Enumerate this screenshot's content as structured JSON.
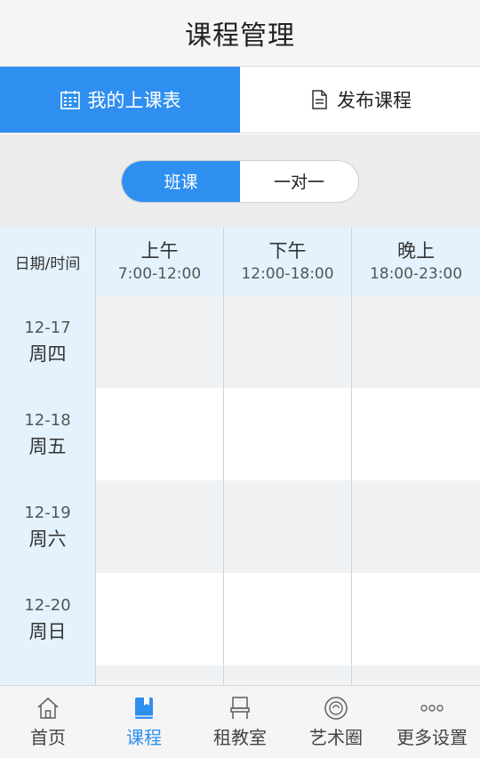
{
  "header": {
    "title": "课程管理"
  },
  "top_tabs": [
    {
      "label": "我的上课表",
      "icon": "calendar-icon",
      "active": true
    },
    {
      "label": "发布课程",
      "icon": "document-icon",
      "active": false
    }
  ],
  "segment": [
    {
      "label": "班课",
      "active": true
    },
    {
      "label": "一对一",
      "active": false
    }
  ],
  "schedule": {
    "corner_label": "日期/时间",
    "periods": [
      {
        "name": "上午",
        "time": "7:00-12:00"
      },
      {
        "name": "下午",
        "time": "12:00-18:00"
      },
      {
        "name": "晚上",
        "time": "18:00-23:00"
      }
    ],
    "rows": [
      {
        "date": "12-17",
        "weekday": "周四"
      },
      {
        "date": "12-18",
        "weekday": "周五"
      },
      {
        "date": "12-19",
        "weekday": "周六"
      },
      {
        "date": "12-20",
        "weekday": "周日"
      }
    ]
  },
  "bottom_nav": [
    {
      "label": "首页",
      "icon": "home-icon",
      "active": false
    },
    {
      "label": "课程",
      "icon": "book-icon",
      "active": true
    },
    {
      "label": "租教室",
      "icon": "chair-icon",
      "active": false
    },
    {
      "label": "艺术圈",
      "icon": "circle-icon",
      "active": false
    },
    {
      "label": "更多设置",
      "icon": "more-icon",
      "active": false
    }
  ],
  "colors": {
    "accent": "#2f8ff0",
    "date_column": "#e3f2fd"
  }
}
